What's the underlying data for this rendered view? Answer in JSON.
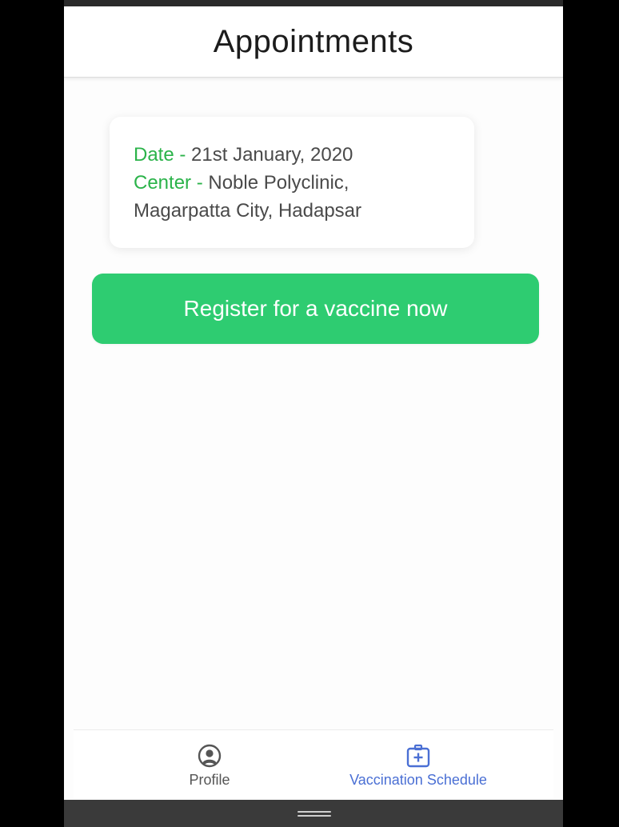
{
  "header": {
    "title": "Appointments"
  },
  "appointment": {
    "date_label": "Date - ",
    "date_value": "21st January, 2020",
    "center_label": "Center - ",
    "center_value": "Noble Polyclinic, Magarpatta City, Hadapsar"
  },
  "register_button": {
    "label": "Register for a vaccine now"
  },
  "bottom_nav": {
    "items": [
      {
        "label": "Profile",
        "icon": "user-circle-icon",
        "active": false
      },
      {
        "label": "Vaccination Schedule",
        "icon": "medical-kit-icon",
        "active": true
      }
    ]
  },
  "colors": {
    "accent_green": "#2ecc71",
    "label_green": "#2bb34a",
    "active_nav": "#4a6fd4",
    "text_gray": "#4a4a4a"
  }
}
